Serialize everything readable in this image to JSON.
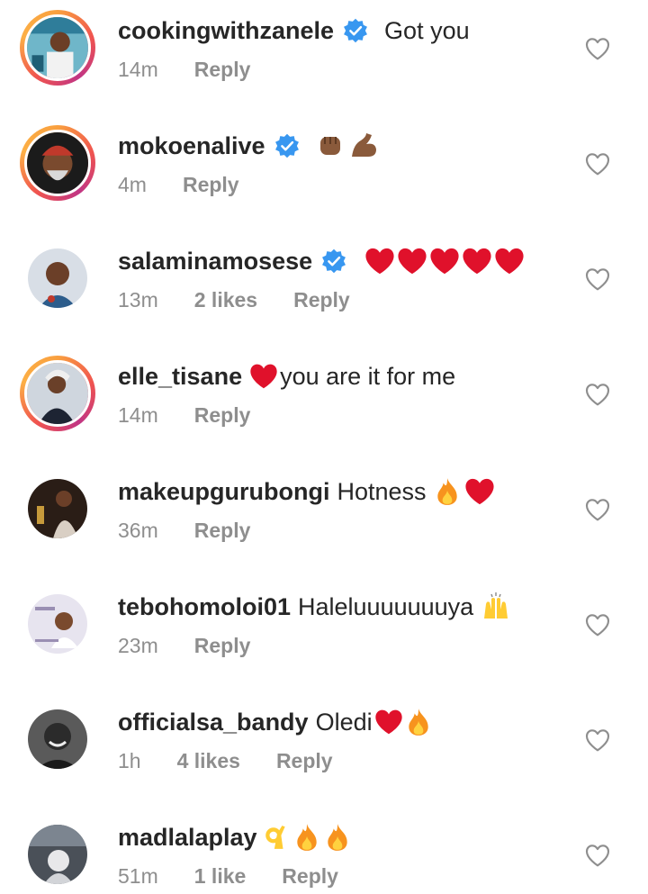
{
  "comments": [
    {
      "username": "cookingwithzanele",
      "verified": true,
      "text": "Got you",
      "time": "14m",
      "likes": "",
      "reply": "Reply",
      "emojis": []
    },
    {
      "username": "mokoenalive",
      "verified": true,
      "text": "",
      "time": "4m",
      "likes": "",
      "reply": "Reply",
      "emojis": [
        "raised-fist",
        "flexed-biceps"
      ]
    },
    {
      "username": "salaminamosese",
      "verified": true,
      "text": "",
      "time": "13m",
      "likes": "2 likes",
      "reply": "Reply",
      "emojis": [
        "red-heart",
        "red-heart",
        "red-heart",
        "red-heart",
        "red-heart"
      ]
    },
    {
      "username": "elle_tisane",
      "verified": false,
      "text": "you are it for me",
      "time": "14m",
      "likes": "",
      "reply": "Reply",
      "emojis": [
        "red-heart"
      ]
    },
    {
      "username": "makeupgurubongi",
      "verified": false,
      "text": "Hotness",
      "time": "36m",
      "likes": "",
      "reply": "Reply",
      "emojis": [
        "fire",
        "red-heart"
      ]
    },
    {
      "username": "tebohomoloi01",
      "verified": false,
      "text": "Haleluuuuuuuya",
      "time": "23m",
      "likes": "",
      "reply": "Reply",
      "emojis": [
        "raising-hands"
      ]
    },
    {
      "username": "officialsa_bandy",
      "verified": false,
      "text": "Oledi",
      "time": "1h",
      "likes": "4 likes",
      "reply": "Reply",
      "emojis": [
        "red-heart",
        "fire"
      ]
    },
    {
      "username": "madlalaplay",
      "verified": false,
      "text": "",
      "time": "51m",
      "likes": "1 like",
      "reply": "Reply",
      "emojis": [
        "ok-hand",
        "fire",
        "fire"
      ]
    }
  ],
  "icons": {
    "like": "heart-outline-icon",
    "verified": "verified-badge-icon"
  },
  "colors": {
    "verified": "#3897f0",
    "heart": "#e0112b",
    "muted": "#8e8e8e"
  }
}
